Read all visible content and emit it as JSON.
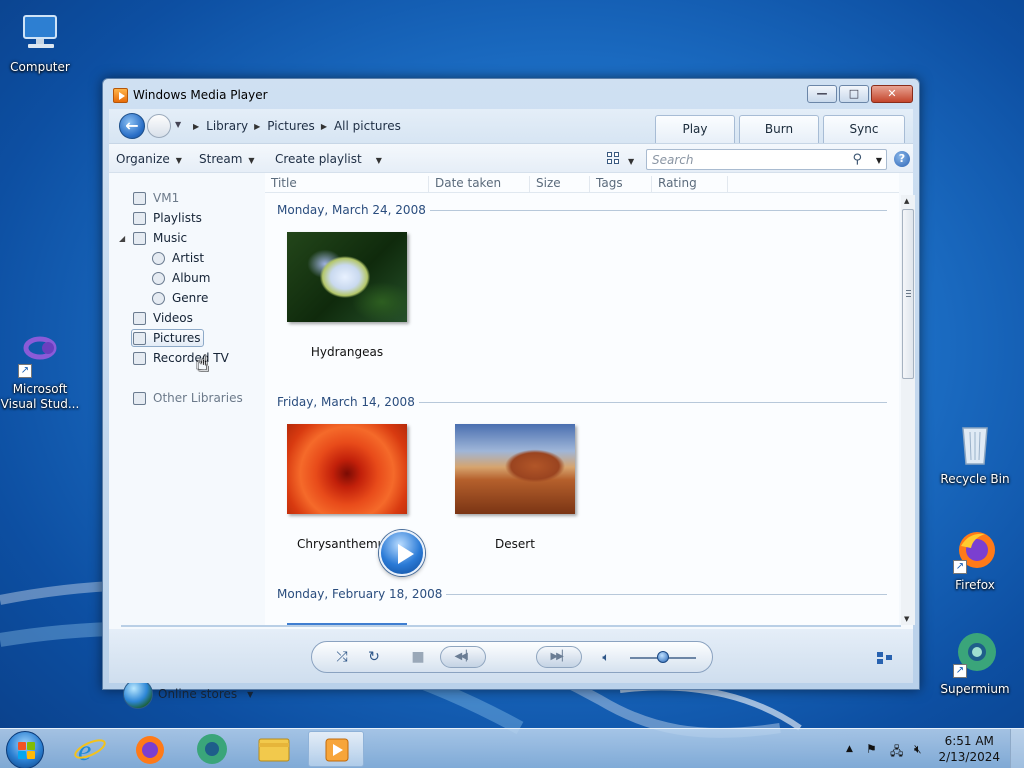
{
  "colors": {
    "accent": "#2a6fc7",
    "desktop": "#1e72c9",
    "group_text": "#2a4d7e"
  },
  "desktop": {
    "icons": [
      {
        "label": "Computer",
        "icon": "computer-icon"
      },
      {
        "label": "Microsoft Visual Stud...",
        "icon": "visual-studio-icon"
      },
      {
        "label": "Recycle Bin",
        "icon": "recycle-bin-icon"
      },
      {
        "label": "Firefox",
        "icon": "firefox-icon"
      },
      {
        "label": "Supermium",
        "icon": "supermium-icon"
      }
    ]
  },
  "window": {
    "title": "Windows Media Player",
    "breadcrumb": [
      "Library",
      "Pictures",
      "All pictures"
    ],
    "tabs": [
      "Play",
      "Burn",
      "Sync"
    ],
    "toolbar": {
      "organize": "Organize",
      "stream": "Stream",
      "create_playlist": "Create playlist",
      "search_placeholder": "Search"
    },
    "nav": {
      "vm": "VM1",
      "playlists": "Playlists",
      "music": "Music",
      "artist": "Artist",
      "album": "Album",
      "genre": "Genre",
      "videos": "Videos",
      "pictures": "Pictures",
      "recorded_tv": "Recorded TV",
      "other_libraries": "Other Libraries",
      "online_stores": "Online stores"
    },
    "columns": [
      "Title",
      "Date taken",
      "Size",
      "Tags",
      "Rating"
    ],
    "groups": [
      {
        "date": "Monday, March 24, 2008",
        "items": [
          "Hydrangeas"
        ]
      },
      {
        "date": "Friday, March 14, 2008",
        "items": [
          "Chrysanthemum",
          "Desert"
        ]
      },
      {
        "date": "Monday, February 18, 2008",
        "items": []
      }
    ]
  },
  "player": {
    "volume_fraction": 0.5
  },
  "taskbar": {
    "apps": [
      "internet-explorer-icon",
      "firefox-icon",
      "supermium-icon",
      "file-explorer-icon",
      "windows-media-player-icon"
    ],
    "time": "6:51 AM",
    "date": "2/13/2024"
  }
}
